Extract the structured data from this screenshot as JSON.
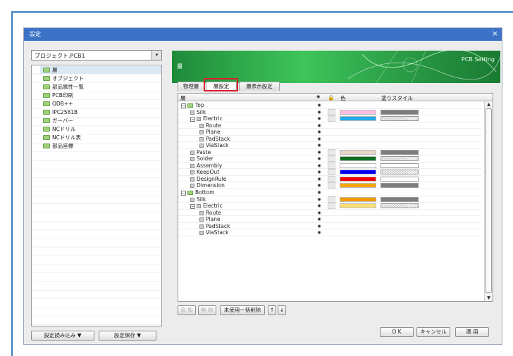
{
  "window": {
    "title": "設定",
    "close_glyph": "×"
  },
  "left": {
    "project": "プロジェクト.PCB1",
    "dropdown_glyph": "▾",
    "tree": [
      "層",
      "オブジェクト",
      "部品属性一覧",
      "PCB印刷",
      "ODB++",
      "IPC2581B",
      "ガーバー",
      "NCドリル",
      "NCドリル表",
      "部品座標"
    ],
    "load_button": "設定読み込み ▼",
    "save_button": "設定保存 ▼"
  },
  "banner": {
    "title": "層",
    "subtitle": "PCB Setting"
  },
  "tabs": [
    "物理層",
    "層設定",
    "層表示設定"
  ],
  "grid": {
    "headers": {
      "layer": "層",
      "color": "色",
      "fill": "塗りスタイル"
    },
    "rows": [
      {
        "label": "Top",
        "level": 0,
        "type": "folder",
        "expand": "⊟"
      },
      {
        "label": "Silk",
        "level": 1,
        "color": "#f9bedf",
        "fill": "solid"
      },
      {
        "label": "Electric",
        "level": 1,
        "expand": "⊟",
        "color": "#1fa9e8",
        "fill": "hatch"
      },
      {
        "label": "Route",
        "level": 2
      },
      {
        "label": "Plane",
        "level": 2
      },
      {
        "label": "PadStack",
        "level": 2
      },
      {
        "label": "ViaStack",
        "level": 2
      },
      {
        "label": "Paste",
        "level": 1,
        "color": "#e6d6ca",
        "fill": "solid"
      },
      {
        "label": "Solder",
        "level": 1,
        "color": "#0a6f1e",
        "fill": "hatch"
      },
      {
        "label": "Assembly",
        "level": 1,
        "color": "#ffffff",
        "fill": "white"
      },
      {
        "label": "KeepOut",
        "level": 1,
        "color": "#0000f0",
        "fill": "hatch"
      },
      {
        "label": "DesignRule",
        "level": 1,
        "color": "#f00000",
        "fill": "white"
      },
      {
        "label": "Dimension",
        "level": 1,
        "color": "#f7a600",
        "fill": "solid"
      },
      {
        "label": "Bottom",
        "level": 0,
        "type": "folder",
        "expand": "⊟"
      },
      {
        "label": "Silk",
        "level": 1,
        "color": "#f29a00",
        "fill": "solid"
      },
      {
        "label": "Electric",
        "level": 1,
        "expand": "⊟",
        "color": "#fadf74",
        "fill": "hatch"
      },
      {
        "label": "Route",
        "level": 2
      },
      {
        "label": "Plane",
        "level": 2
      },
      {
        "label": "PadStack",
        "level": 2
      },
      {
        "label": "ViaStack",
        "level": 2
      }
    ]
  },
  "grid_buttons": {
    "add": "追 加",
    "delete": "削 除",
    "remove_unused": "未使用一括削除",
    "up": "↑",
    "down": "↓"
  },
  "footer": {
    "ok": "O K",
    "cancel": "キャンセル",
    "apply": "適 用"
  }
}
